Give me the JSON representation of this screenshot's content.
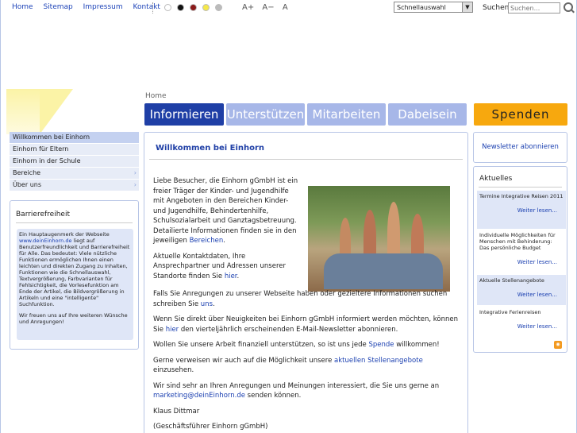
{
  "topnav": {
    "home": "Home",
    "sitemap": "Sitemap",
    "impressum": "Impressum",
    "kontakt": "Kontakt"
  },
  "font_controls": {
    "larger": "A+",
    "smaller": "A−",
    "reset": "A"
  },
  "color_swatches": [
    "#ffffff",
    "#111111",
    "#8b1a1a",
    "#f5e84a",
    "#bbbbbb"
  ],
  "quick_select": {
    "selected": "Schnellauswahl"
  },
  "search": {
    "label": "Suchen",
    "placeholder": "Suchen..."
  },
  "breadcrumb": "Home",
  "tabs": [
    {
      "label": "Informieren",
      "active": true
    },
    {
      "label": "Unterstützen",
      "active": false
    },
    {
      "label": "Mitarbeiten",
      "active": false
    },
    {
      "label": "Dabeisein",
      "active": false
    }
  ],
  "spenden_label": "Spenden",
  "sidebar": {
    "items": [
      {
        "label": "Willkommen bei Einhorn"
      },
      {
        "label": "Einhorn für Eltern"
      },
      {
        "label": "Einhorn in der Schule"
      },
      {
        "label": "Bereiche"
      },
      {
        "label": "Über uns"
      }
    ]
  },
  "barriere": {
    "title": "Barrierefreiheit",
    "text1": "Ein Hauptaugenmerk der Webseite",
    "link": "www.deinEinhorn.de",
    "text2": "liegt auf Benutzerfreundlichkeit und Barrierefreiheit für Alle. Das bedeutet: Viele nützliche Funktionen ermöglichen Ihnen einen leichten und direkten Zugang zu Inhalten, Funktionen wie die Schnellauswahl, Textvergrößerung, Farbvarianten für Fehlsichtigkeit, die Vorlesefunktion am Ende der Artikel, die Bildvergrößerung in Artikeln und eine \"intelligente\" Suchfunktion.",
    "text3": "Wir freuen uns auf Ihre weiteren Wünsche und Anregungen!"
  },
  "main": {
    "title": "Willkommen bei Einhorn",
    "p1": "Liebe Besucher, die Einhorn gGmbH ist ein freier Träger der Kinder- und Jugendhilfe mit Angeboten in den Bereichen Kinder- und Jugendhilfe, Behindertenhilfe, Schulsozialarbeit und Ganztagsbetreuung. Detailierte Informationen finden sie in den jeweiligen",
    "p1_link": "Bereichen",
    "p2": "Aktuelle Kontaktdaten, Ihre Ansprechpartner und Adressen unserer Standorte finden Sie",
    "p2_link": "hier",
    "p3": "Falls Sie Anregungen zu unserer Webseite haben oder gezieltere Informationen suchen schreiben Sie",
    "p3_link": "uns",
    "p4a": "Wenn Sie direkt über Neuigkeiten bei Einhorn gGmbH informiert werden möchten, können Sie",
    "p4_link": "hier",
    "p4b": "den vierteljährlich erscheinenden E-Mail-Newsletter abonnieren.",
    "p5a": "Wollen Sie unsere Arbeit finanziell unterstützen, so ist uns jede",
    "p5_link": "Spende",
    "p5b": "willkommen!",
    "p6a": "Gerne verweisen wir auch auf die Möglichkeit unsere",
    "p6_link": "aktuellen Stellenangebote",
    "p6b": "einzusehen.",
    "p7a": "Wir sind sehr an Ihren Anregungen und Meinungen interessiert, die Sie uns gerne an",
    "p7_link": "marketing@deinEinhorn.de",
    "p7b": "senden können.",
    "sign1": "Klaus Dittmar",
    "sign2": "(Geschäftsführer Einhorn gGmbH)"
  },
  "newsletter": "Newsletter abonnieren",
  "aktuelles": {
    "title": "Aktuelles",
    "items": [
      {
        "title": "Termine Integrative Reisen 2011",
        "more": "Weiter lesen..."
      },
      {
        "title": "Individuelle Möglichkeiten für Menschen mit Behinderung: Das persönliche Budget",
        "more": "Weiter lesen..."
      },
      {
        "title": "Aktuelle Stellenangebote",
        "more": "Weiter lesen..."
      },
      {
        "title": "Integrative Ferienreisen",
        "more": "Weiter lesen..."
      }
    ]
  },
  "icons": {
    "search": "magnifier-icon",
    "rss": "rss-icon",
    "chevron": "chevron-right-icon"
  }
}
